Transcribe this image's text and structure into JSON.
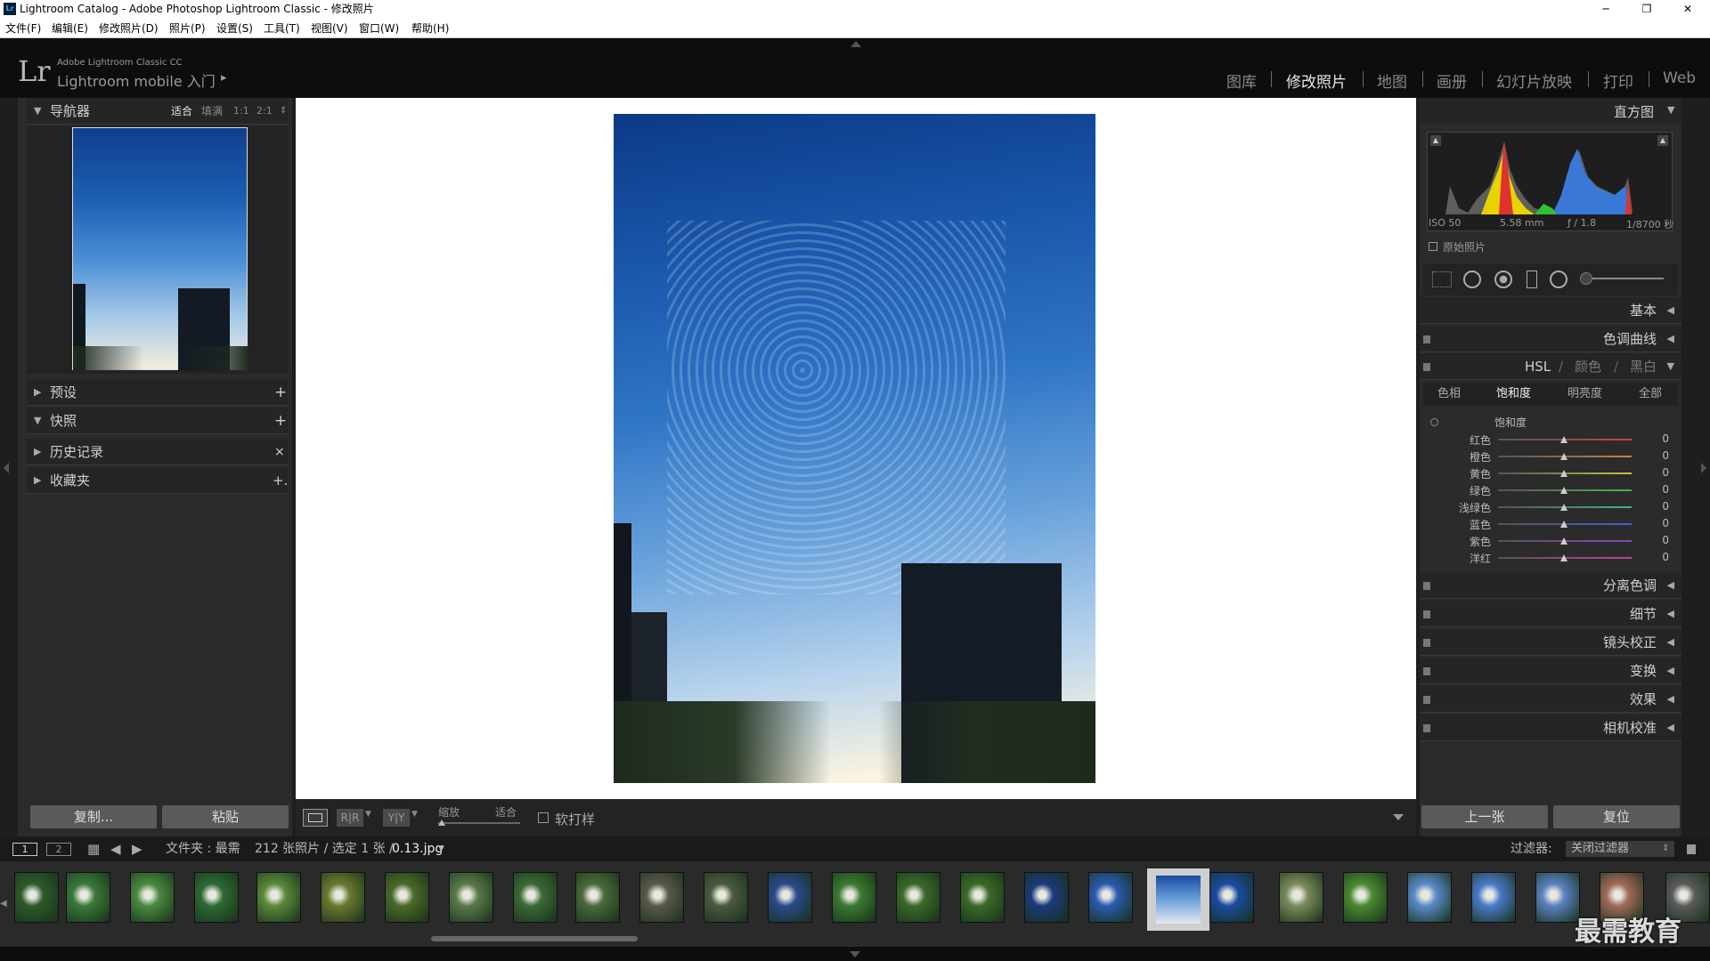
{
  "window": {
    "app_icon": "Lr",
    "title": "Lightroom Catalog - Adobe Photoshop Lightroom Classic - 修改照片",
    "min": "─",
    "max": "❐",
    "close": "✕"
  },
  "menu": [
    "文件(F)",
    "编辑(E)",
    "修改照片(D)",
    "照片(P)",
    "设置(S)",
    "工具(T)",
    "视图(V)",
    "窗口(W)",
    "帮助(H)"
  ],
  "identity": {
    "logo": "Lr",
    "product": "Adobe Lightroom Classic CC",
    "mobile": "Lightroom mobile 入门",
    "arrow": "▸"
  },
  "modules": [
    "图库",
    "修改照片",
    "地图",
    "画册",
    "幻灯片放映",
    "打印",
    "Web"
  ],
  "active_module": "修改照片",
  "navigator": {
    "title": "导航器",
    "zoom_options": [
      "适合",
      "填满",
      "1:1",
      "2:1"
    ],
    "active_zoom": "适合"
  },
  "left_sections": [
    {
      "label": "预设",
      "action": "+"
    },
    {
      "label": "快照",
      "action": "+"
    },
    {
      "label": "历史记录",
      "action": "×"
    },
    {
      "label": "收藏夹",
      "action": "+."
    }
  ],
  "left_buttons": {
    "copy": "复制...",
    "paste": "粘贴"
  },
  "histogram": {
    "title": "直方图",
    "iso": "ISO 50",
    "focal": "5.58 mm",
    "aperture": "ƒ / 1.8",
    "shutter": "1/8700 秒",
    "original": "原始照片"
  },
  "right_sections_top": [
    {
      "label": "基本"
    },
    {
      "label": "色调曲线"
    }
  ],
  "hsl": {
    "header": [
      "HSL",
      "颜色",
      "黑白"
    ],
    "tabs": [
      "色相",
      "饱和度",
      "明亮度",
      "全部"
    ],
    "active_tab": "饱和度",
    "group_title": "饱和度",
    "rows": [
      {
        "name": "红色",
        "value": "0",
        "color": "#d04040"
      },
      {
        "name": "橙色",
        "value": "0",
        "color": "#d08040"
      },
      {
        "name": "黄色",
        "value": "0",
        "color": "#c8c040"
      },
      {
        "name": "绿色",
        "value": "0",
        "color": "#50b050"
      },
      {
        "name": "浅绿色",
        "value": "0",
        "color": "#40b0a0"
      },
      {
        "name": "蓝色",
        "value": "0",
        "color": "#4060d0"
      },
      {
        "name": "紫色",
        "value": "0",
        "color": "#9040c0"
      },
      {
        "name": "洋红",
        "value": "0",
        "color": "#c040a0"
      }
    ]
  },
  "right_sections_bottom": [
    {
      "label": "分离色调"
    },
    {
      "label": "细节"
    },
    {
      "label": "镜头校正"
    },
    {
      "label": "变换"
    },
    {
      "label": "效果"
    },
    {
      "label": "相机校准"
    }
  ],
  "right_buttons": {
    "prev": "上一张",
    "reset": "复位"
  },
  "toolbar": {
    "zoom_label": "缩放",
    "zoom_value": "适合",
    "softproof": "软打样",
    "view_ry1": "R|R",
    "view_ry2": "Y|Y"
  },
  "filmbar": {
    "page1": "1",
    "page2": "2",
    "folder": "文件夹 : 最需",
    "count": "212 张照片 / 选定 1 张 /",
    "filename": "0.13.jpg",
    "filter_label": "过滤器:",
    "filter_value": "关闭过滤器"
  },
  "watermark": "最需教育"
}
